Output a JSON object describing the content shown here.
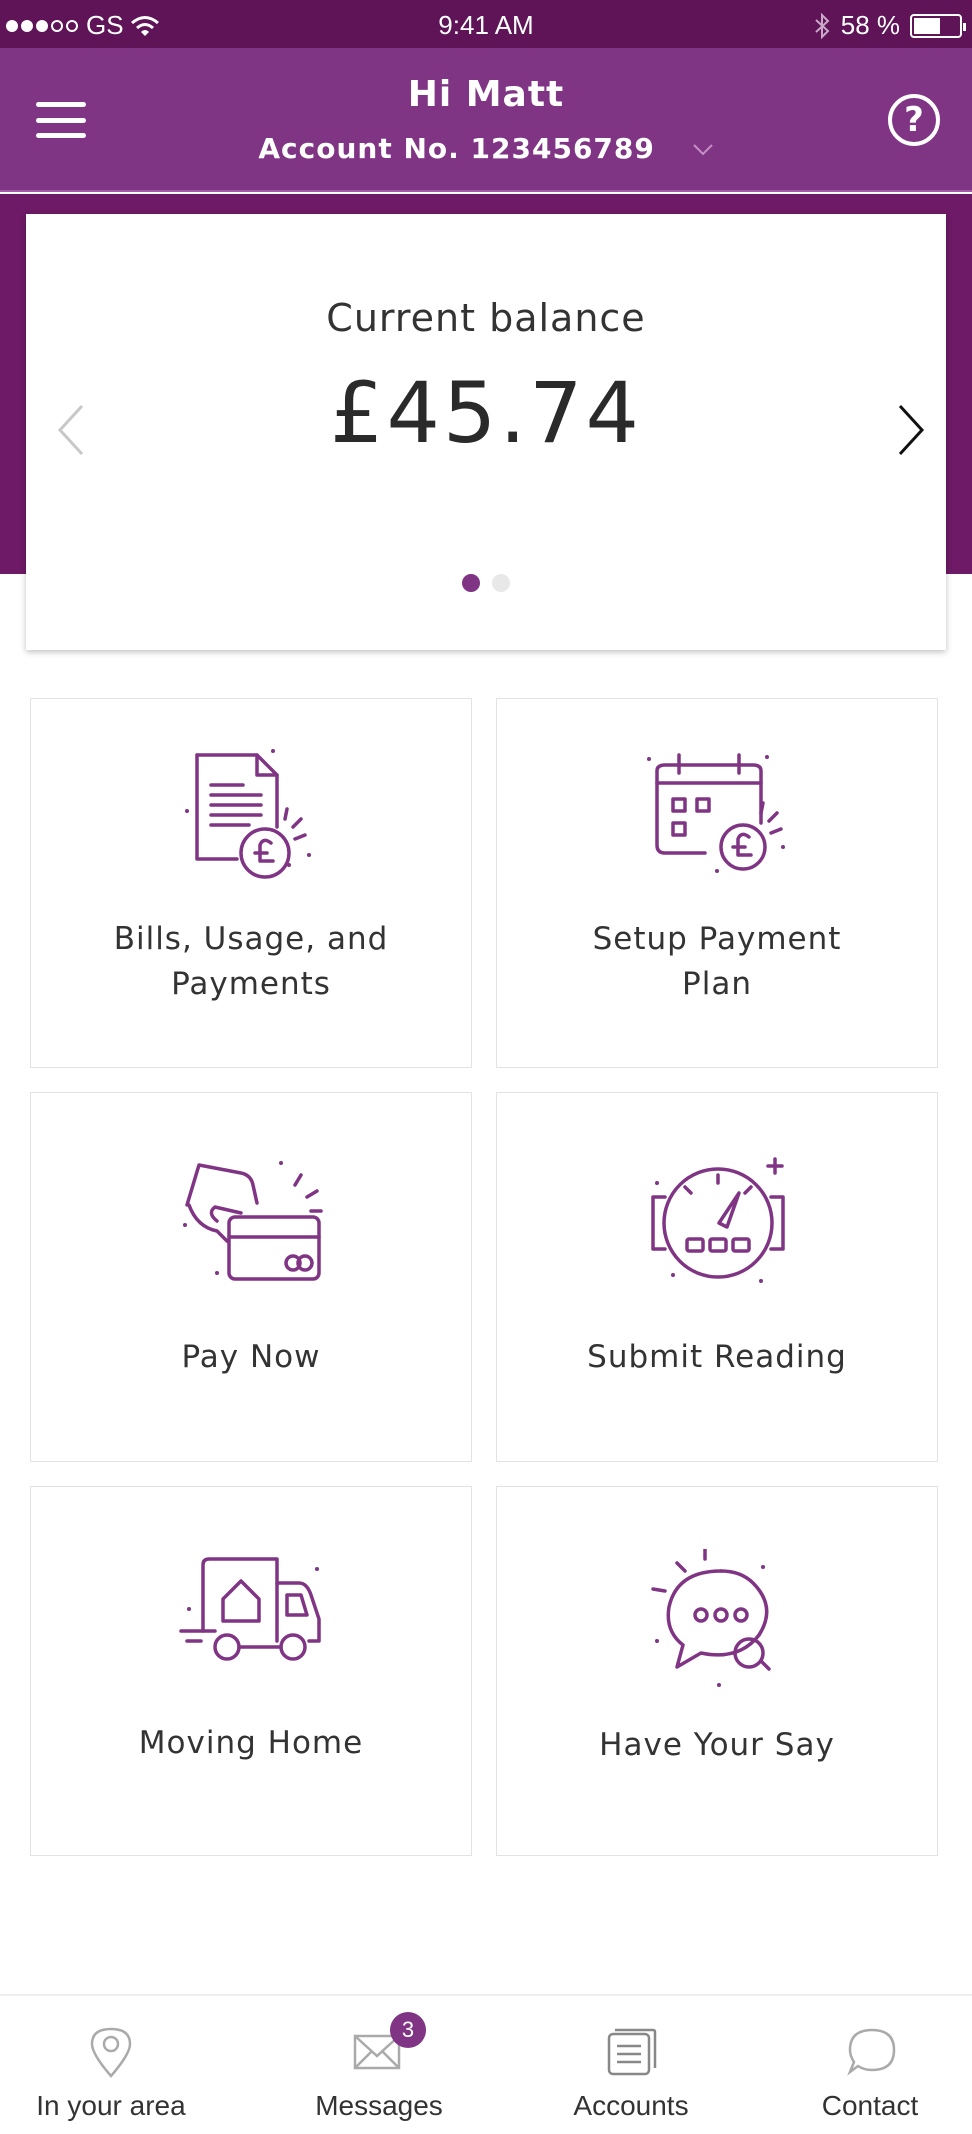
{
  "status_bar": {
    "carrier": "GS",
    "time": "9:41 AM",
    "battery_text": "58 %",
    "battery_level": 0.58,
    "signal_bars": 3
  },
  "header": {
    "greeting": "Hi Matt",
    "account_text": "Account No. 123456789"
  },
  "balance_card": {
    "label": "Current balance",
    "value": "£45.74",
    "pages": 2,
    "active_page": 1
  },
  "tiles": [
    {
      "label_line1": "Bills, Usage, and",
      "label_line2": "Payments",
      "icon": "bill-pound-icon"
    },
    {
      "label_line1": "Setup Payment",
      "label_line2": "Plan",
      "icon": "calendar-pound-icon"
    },
    {
      "label_line1": "Pay Now",
      "icon": "hand-card-icon"
    },
    {
      "label_line1": "Submit Reading",
      "icon": "meter-gauge-icon"
    },
    {
      "label_line1": "Moving Home",
      "icon": "moving-van-icon"
    },
    {
      "label_line1": "Have Your Say",
      "icon": "chat-bubble-icon"
    }
  ],
  "bottom_nav": {
    "items": [
      {
        "label": "In your area",
        "icon": "location-pin-icon"
      },
      {
        "label": "Messages",
        "icon": "envelope-icon",
        "badge": "3"
      },
      {
        "label": "Accounts",
        "icon": "documents-icon"
      },
      {
        "label": "Contact",
        "icon": "speech-bubble-icon"
      }
    ]
  },
  "colors": {
    "brand_purple": "#803484",
    "dark_purple": "#6e1a66",
    "status_bar": "#5e1457"
  }
}
